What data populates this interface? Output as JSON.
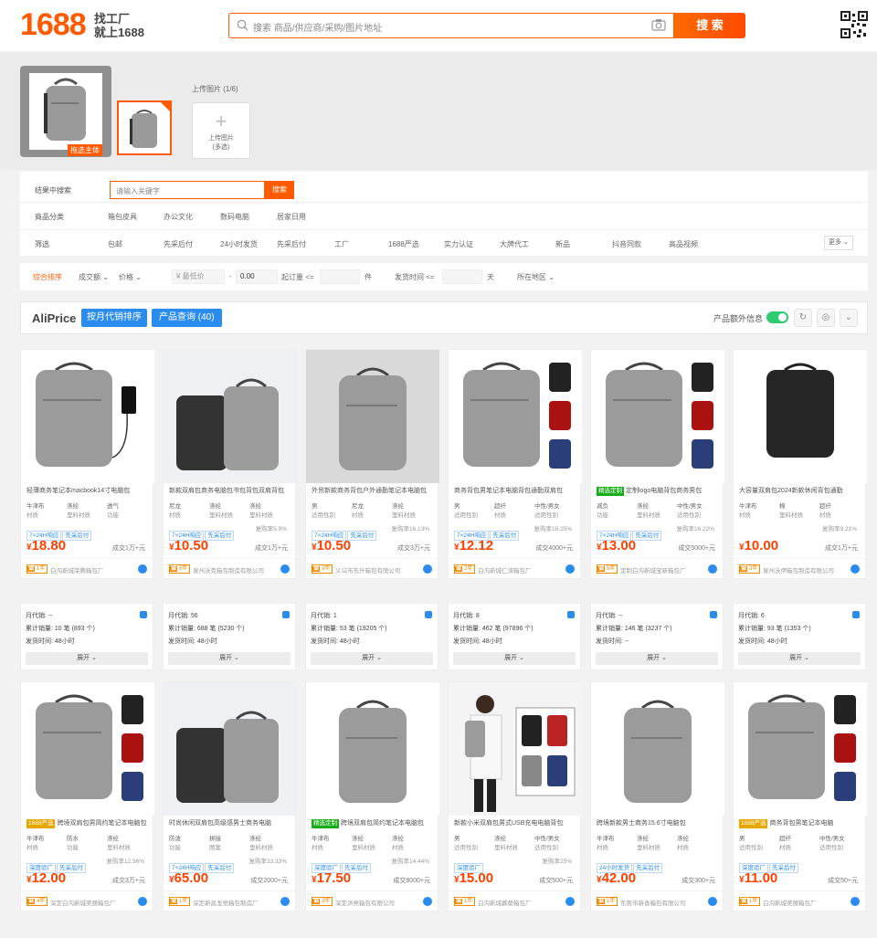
{
  "header": {
    "logo": "1688",
    "logo_sub1": "找工厂",
    "logo_sub2": "就上1688",
    "search_placeholder": "搜索 商品/供应商/采购/图片地址",
    "search_button": "搜 索"
  },
  "upload": {
    "main_tag": "拖选主体",
    "label": "上传图片 (1/6)",
    "button_line1": "上传图片",
    "button_line2": "(多选)"
  },
  "filters": {
    "in_results_label": "结果中搜索",
    "in_results_placeholder": "请输入关键字",
    "in_results_button": "搜索",
    "category_label": "商品分类",
    "categories": [
      "箱包皮具",
      "办公文化",
      "数码电脑",
      "居家日用"
    ],
    "filter_label": "筛选",
    "filter_options": [
      "包邮",
      "先采后付",
      "24小时发货",
      "先采后付",
      "工厂",
      "1688严选",
      "实力认证",
      "大牌代工",
      "新品",
      "抖音同款",
      "高品视频"
    ],
    "more": "更多"
  },
  "sortbar": {
    "items": [
      "综合排序",
      "成交额",
      "价格"
    ],
    "price_min": "¥ 最低价",
    "price_max": "0.00",
    "moq_label": "起订量 <=",
    "moq_unit": "件",
    "ship_label": "发货时间 <=",
    "ship_unit": "天",
    "region": "所在地区"
  },
  "aliprice": {
    "brand": "AliPrice",
    "btn_sort": "按月代销排序",
    "btn_query": "产品查询 (40)",
    "info_label": "产品额外信息"
  },
  "products": [
    {
      "title": "轻薄商务笔记本macbook14寸电脑包",
      "badge": "",
      "attrs": [
        [
          "牛津布",
          "材质"
        ],
        [
          "涤纶",
          "里料材质"
        ],
        [
          "透气",
          "功能"
        ]
      ],
      "tags": [
        "7×24H响应",
        "先采后付"
      ],
      "rate": "",
      "price": "18.80",
      "sold": "成交1万+元",
      "years": "1年",
      "shop": "白沟新城荣腾箱包厂"
    },
    {
      "title": "新款双肩包商务电脑包书包背包双肩背包",
      "badge": "",
      "attrs": [
        [
          "尼龙",
          "材质"
        ],
        [
          "涤纶",
          "里料材质"
        ],
        [
          "涤纶",
          "里料材质"
        ]
      ],
      "tags": [
        "7×24H响应",
        "先采后付"
      ],
      "rate": "复购率5.9%",
      "price": "10.50",
      "sold": "成交1万+元",
      "years": "5年",
      "shop": "泉州沃克箱包制造有限公司"
    },
    {
      "title": "外贸新款商务背包户外通勤笔记本电脑包",
      "badge": "",
      "attrs": [
        [
          "男",
          "适用性别"
        ],
        [
          "尼龙",
          "材质"
        ],
        [
          "涤纶",
          "里料材质"
        ]
      ],
      "tags": [
        "7×24H响应",
        "先采后付"
      ],
      "rate": "复购率16.13%",
      "price": "10.50",
      "sold": "成交3万+元",
      "years": "3年",
      "shop": "义乌市东升箱包有限公司"
    },
    {
      "title": "商务背包男笔记本电脑背包通勤双肩包",
      "badge": "",
      "attrs": [
        [
          "男",
          "适用性别"
        ],
        [
          "超纤",
          "材质"
        ],
        [
          "中性/男女",
          "适用性别"
        ]
      ],
      "tags": [
        "7×24H响应",
        "先采后付"
      ],
      "rate": "复购率15.25%",
      "price": "12.12",
      "sold": "成交4000+元",
      "years": "2年",
      "shop": "白沟新城仁涛箱包厂"
    },
    {
      "title": "定制logo电脑背包商务男包",
      "badge": "精选定制",
      "attrs": [
        [
          "减负",
          "功能"
        ],
        [
          "涤纶",
          "里料材质"
        ],
        [
          "中性/男女",
          "适用性别"
        ]
      ],
      "tags": [
        "7×24H响应",
        "先采后付"
      ],
      "rate": "复购率16.22%",
      "price": "13.00",
      "sold": "成交5000+元",
      "years": "5年",
      "shop": "定制白沟新城宝新箱包厂"
    },
    {
      "title": "大容量双肩包2024新款休闲背包通勤",
      "badge": "",
      "attrs": [
        [
          "牛津布",
          "材质"
        ],
        [
          "棉",
          "里料材质"
        ],
        [
          "超纤",
          "材质"
        ]
      ],
      "tags": [],
      "rate": "复购率9.21%",
      "price": "10.00",
      "sold": "成交1万+元",
      "years": "3年",
      "shop": "泉州沃伊箱包制造有限公司"
    },
    {
      "title": "跨境双肩包男简约笔记本电脑包",
      "badge": "1688严选",
      "attrs": [
        [
          "牛津布",
          "材质"
        ],
        [
          "防水",
          "功能"
        ],
        [
          "涤纶",
          "里料材质"
        ]
      ],
      "tags": [
        "深度验厂",
        "先采后付"
      ],
      "rate": "复购率12.96%",
      "price": "12.00",
      "sold": "成交3万+元",
      "years": "4年",
      "shop": "深定白沟新城美丽箱包厂"
    },
    {
      "title": "时尚休闲双肩包高级感男士商务电脑",
      "badge": "",
      "attrs": [
        [
          "防泼",
          "功能"
        ],
        [
          "拼接",
          "图案"
        ],
        [
          "涤纶",
          "里料材质"
        ]
      ],
      "tags": [
        "7×24H响应",
        "先采后付"
      ],
      "rate": "复购率33.33%",
      "price": "65.00",
      "sold": "成交2000+元",
      "years": "1年",
      "shop": "深定新昌龙觉箱包制造厂"
    },
    {
      "title": "跨境双肩包简约笔记本电脑包",
      "badge": "精选定制",
      "attrs": [
        [
          "牛津布",
          "材质"
        ],
        [
          "涤纶",
          "里料材质"
        ],
        [
          "涤纶",
          "材质"
        ]
      ],
      "tags": [
        "深度验厂",
        "先采后付"
      ],
      "rate": "复购率14.44%",
      "price": "17.50",
      "sold": "成交8000+元",
      "years": "3年",
      "shop": "深定洪亮箱包有限公司"
    },
    {
      "title": "新款小米双肩包男式USB充电电脑背包",
      "badge": "",
      "attrs": [
        [
          "男",
          "适用性别"
        ],
        [
          "涤纶",
          "里料材质"
        ],
        [
          "中性/男女",
          "适用性别"
        ]
      ],
      "tags": [
        "深度验厂"
      ],
      "rate": "复购率25%",
      "price": "15.00",
      "sold": "成交500+元",
      "years": "1年",
      "shop": "白沟新城慕葵箱包厂"
    },
    {
      "title": "跨境新款男士商务15.6寸电脑包",
      "badge": "",
      "attrs": [
        [
          "牛津布",
          "材质"
        ],
        [
          "涤纶",
          "里料材质"
        ],
        [
          "涤纶",
          "材质"
        ]
      ],
      "tags": [
        "24小时发货",
        "先采后付"
      ],
      "rate": "",
      "price": "42.00",
      "sold": "成交300+元",
      "years": "1年",
      "shop": "东莞市新香箱包有限公司"
    },
    {
      "title": "商务背包男笔记本电脑",
      "badge": "1688严选",
      "attrs": [
        [
          "男",
          "适用性别"
        ],
        [
          "超纤",
          "材质"
        ],
        [
          "中性/男女",
          "适用性别"
        ]
      ],
      "tags": [
        "深度验厂",
        "先采后付"
      ],
      "rate": "",
      "price": "11.00",
      "sold": "成交50+元",
      "years": "1年",
      "shop": "白沟新城美丽箱包厂"
    }
  ],
  "ext": [
    {
      "monthly": "月代销: --",
      "total": "累计销量: 10 笔 (893 个)",
      "ship": "发货时间: 48小时"
    },
    {
      "monthly": "月代销: 56",
      "total": "累计销量: 688 笔 (5230 个)",
      "ship": "发货时间: 48小时"
    },
    {
      "monthly": "月代销: 1",
      "total": "累计销量: 53 笔 (19205 个)",
      "ship": "发货时间: 48小时"
    },
    {
      "monthly": "月代销: 8",
      "total": "累计销量: 462 笔 (97896 个)",
      "ship": "发货时间: 48小时"
    },
    {
      "monthly": "月代销: --",
      "total": "累计销量: 146 笔 (3237 个)",
      "ship": "发货时间: --"
    },
    {
      "monthly": "月代销: 6",
      "total": "累计销量: 93 笔 (1353 个)",
      "ship": "发货时间: 48小时"
    }
  ],
  "expand_label": "展开",
  "colors": {
    "accent": "#ff5a00",
    "blue": "#2b8cf0"
  }
}
